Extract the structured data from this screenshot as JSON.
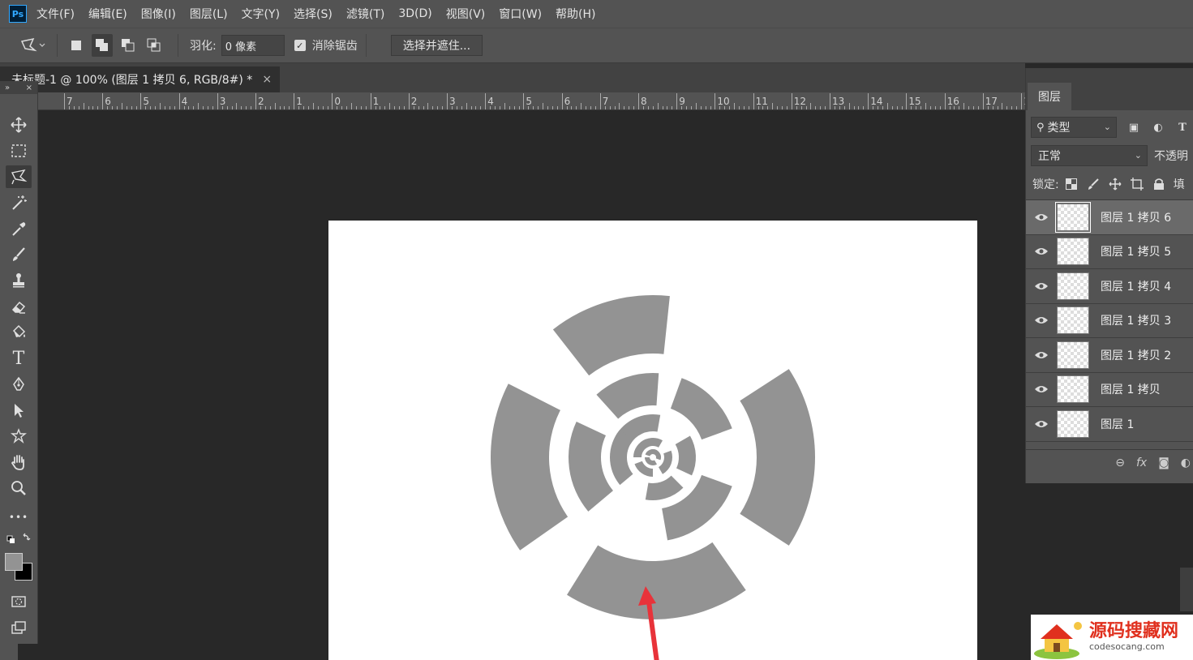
{
  "app": {
    "logo_text": "Ps"
  },
  "menu": [
    "文件(F)",
    "编辑(E)",
    "图像(I)",
    "图层(L)",
    "文字(Y)",
    "选择(S)",
    "滤镜(T)",
    "3D(D)",
    "视图(V)",
    "窗口(W)",
    "帮助(H)"
  ],
  "options": {
    "feather_label": "羽化:",
    "feather_value": "0 像素",
    "antialias_label": "消除锯齿",
    "antialias_checked": "✓",
    "select_mask_label": "选择并遮住..."
  },
  "document": {
    "tab_label": "未标题-1 @ 100% (图层 1 拷贝 6, RGB/8#) *",
    "close_glyph": "×"
  },
  "ruler": {
    "labels": [
      "7",
      "6",
      "5",
      "4",
      "3",
      "2",
      "1",
      "0",
      "1",
      "2",
      "3",
      "4",
      "5",
      "6",
      "7",
      "8",
      "9",
      "10",
      "11",
      "12",
      "13",
      "14",
      "15",
      "16",
      "17",
      "1"
    ]
  },
  "layers_panel": {
    "tab_label": "图层",
    "filter_label": "类型",
    "blend_mode": "正常",
    "opacity_label": "不透明",
    "lock_label": "锁定:",
    "fill_label": "填",
    "layers": [
      {
        "name": "图层 1 拷贝 6",
        "selected": true
      },
      {
        "name": "图层 1 拷贝 5",
        "selected": false
      },
      {
        "name": "图层 1 拷贝 4",
        "selected": false
      },
      {
        "name": "图层 1 拷贝 3",
        "selected": false
      },
      {
        "name": "图层 1 拷贝 2",
        "selected": false
      },
      {
        "name": "图层 1 拷贝",
        "selected": false
      },
      {
        "name": "图层 1",
        "selected": false
      }
    ],
    "footer_fx": "fx"
  },
  "toolbox": {
    "tools": [
      "move-tool",
      "marquee-tool",
      "polygonal-lasso-tool",
      "magic-wand-tool",
      "eyedropper-tool",
      "brush-tool",
      "stamp-tool",
      "eraser-tool",
      "paint-bucket-tool",
      "type-tool",
      "pen-tool",
      "path-select-tool",
      "custom-shape-tool",
      "hand-tool",
      "zoom-tool",
      "more-tools"
    ],
    "type_glyph": "T",
    "more_glyph": "•••",
    "foreground_color": "#939393",
    "background_color": "#000000"
  },
  "canvas": {
    "shape_color": "#939393",
    "arrow_color": "#e8333a"
  },
  "watermark": {
    "title": "源码搜藏网",
    "subtitle": "codesocang.com"
  }
}
